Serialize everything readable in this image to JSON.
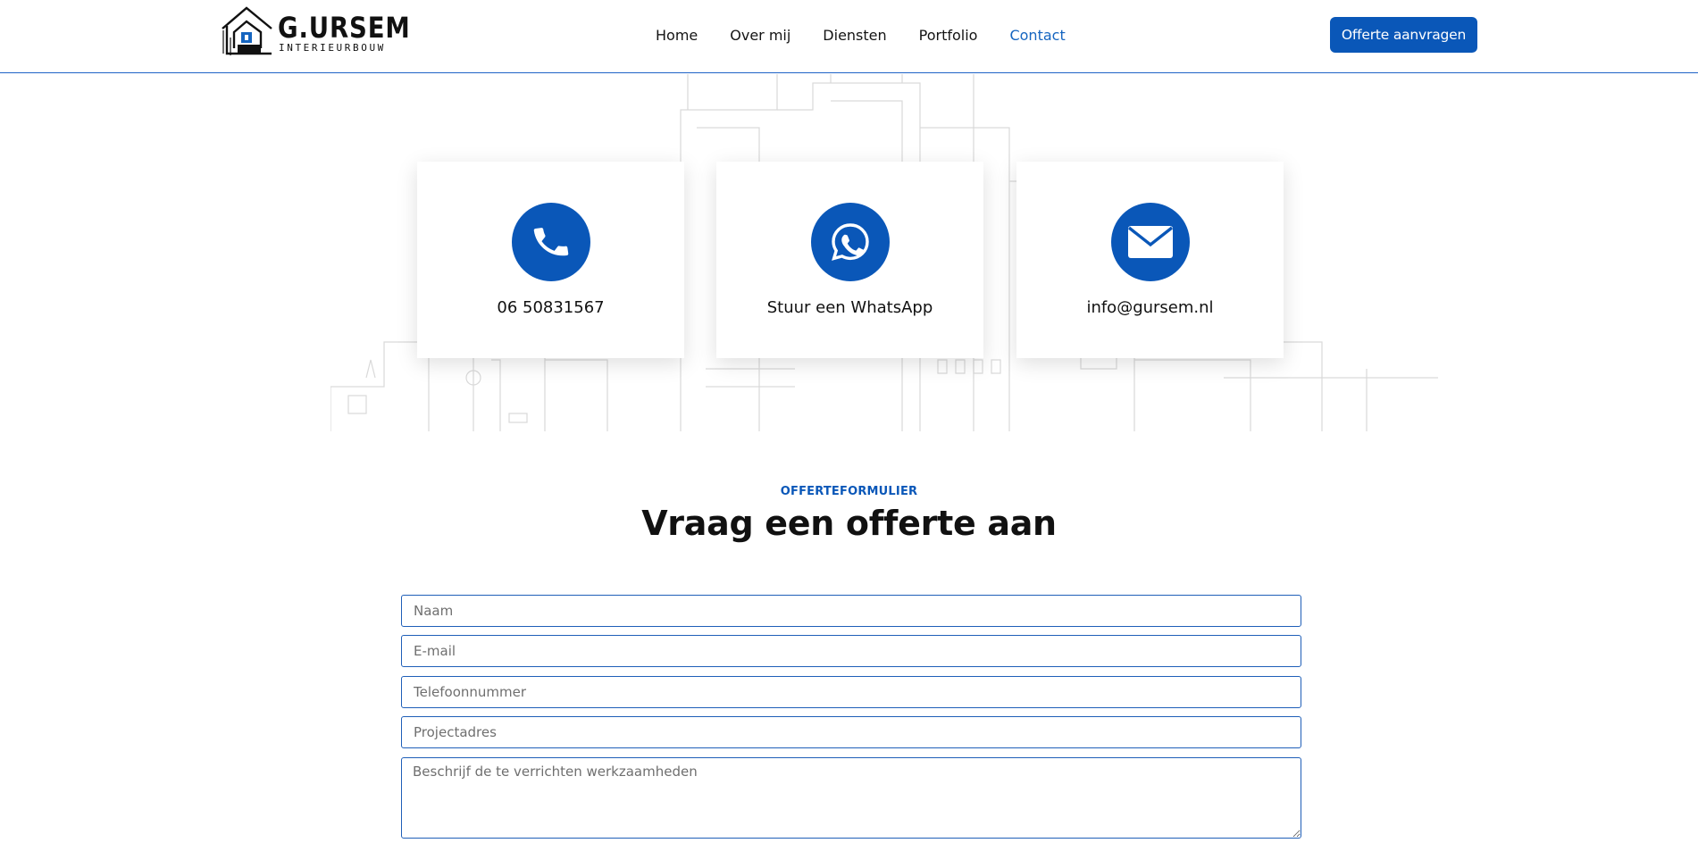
{
  "header": {
    "logo": {
      "name": "G.URSEM",
      "subtitle": "INTERIEURBOUW"
    },
    "nav": [
      {
        "label": "Home",
        "active": false
      },
      {
        "label": "Over mij",
        "active": false
      },
      {
        "label": "Diensten",
        "active": false
      },
      {
        "label": "Portfolio",
        "active": false
      },
      {
        "label": "Contact",
        "active": true
      }
    ],
    "cta_label": "Offerte aanvragen"
  },
  "contact_cards": [
    {
      "icon": "phone-icon",
      "label": "06 50831567"
    },
    {
      "icon": "whatsapp-icon",
      "label": "Stuur een WhatsApp"
    },
    {
      "icon": "envelope-icon",
      "label": "info@gursem.nl"
    }
  ],
  "quote_section": {
    "eyebrow": "OFFERTEFORMULIER",
    "title": "Vraag een offerte aan"
  },
  "form": {
    "name_placeholder": "Naam",
    "email_placeholder": "E-mail",
    "phone_placeholder": "Telefoonnummer",
    "address_placeholder": "Projectadres",
    "description_placeholder": "Beschrijf de te verrichten werkzaamheden"
  },
  "colors": {
    "accent": "#0a57b8",
    "active_nav": "#1565c0",
    "field_border": "#1f5fb8"
  }
}
